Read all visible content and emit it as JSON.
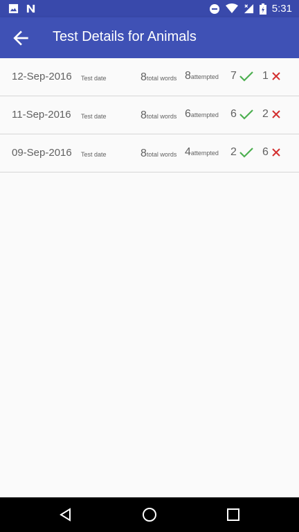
{
  "status_bar": {
    "time": "5:31",
    "left_icons": [
      "image-icon",
      "n-notification-icon"
    ],
    "right_icons": [
      "do-not-disturb-icon",
      "wifi-icon",
      "signal-icon",
      "battery-icon"
    ]
  },
  "app_bar": {
    "title": "Test Details for Animals",
    "back_icon": "arrow-back-icon"
  },
  "rows": [
    {
      "date": "12-Sep-2016",
      "date_label": "Test date",
      "total": "8",
      "total_label": "total words",
      "attempted": "8",
      "attempted_label": "attempted",
      "correct": "7",
      "wrong": "1"
    },
    {
      "date": "11-Sep-2016",
      "date_label": "Test date",
      "total": "8",
      "total_label": "total words",
      "attempted": "6",
      "attempted_label": "attempted",
      "correct": "6",
      "wrong": "2"
    },
    {
      "date": "09-Sep-2016",
      "date_label": "Test date",
      "total": "8",
      "total_label": "total words",
      "attempted": "4",
      "attempted_label": "attempted",
      "correct": "2",
      "wrong": "6"
    }
  ],
  "colors": {
    "status_bar": "#3949ab",
    "app_bar": "#3f51b5",
    "correct": "#4caf50",
    "wrong": "#d32f2f"
  },
  "nav_bar": {
    "icons": [
      "back-triangle-icon",
      "home-circle-icon",
      "recents-square-icon"
    ]
  }
}
